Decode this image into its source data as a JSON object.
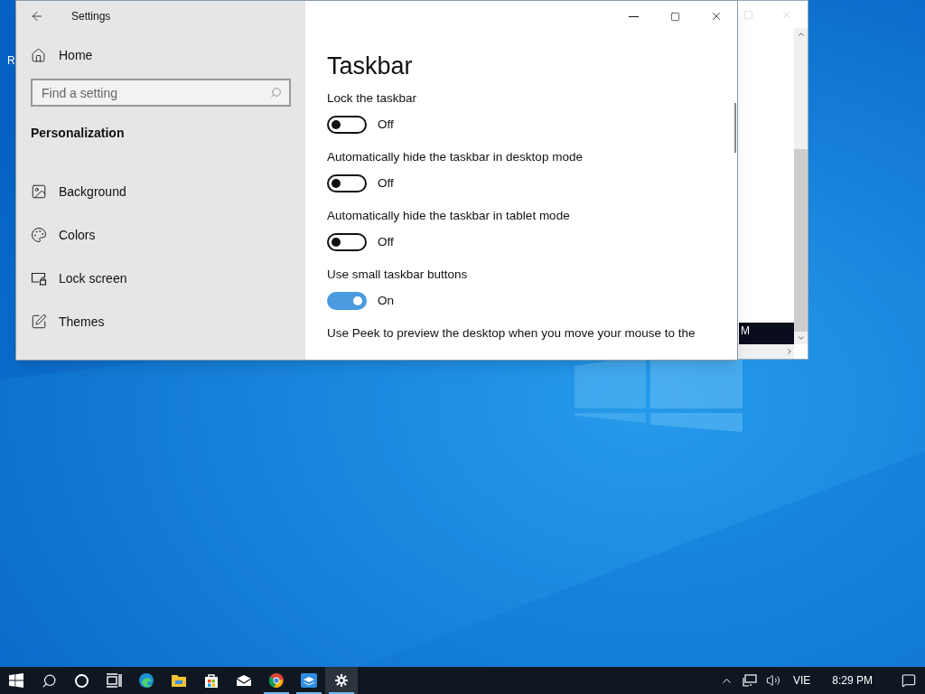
{
  "desktop": {
    "icon_label": "R"
  },
  "background_window": {
    "clock_fragment": "M"
  },
  "window": {
    "title": "Settings"
  },
  "sidebar": {
    "home": "Home",
    "search": {
      "placeholder": "Find a setting"
    },
    "section": "Personalization",
    "items": [
      {
        "label": "Background",
        "selected": false
      },
      {
        "label": "Colors",
        "selected": false
      },
      {
        "label": "Lock screen",
        "selected": false
      },
      {
        "label": "Themes",
        "selected": false
      }
    ]
  },
  "content": {
    "heading": "Taskbar",
    "settings": [
      {
        "label": "Lock the taskbar",
        "on": false,
        "state_text": "Off"
      },
      {
        "label": "Automatically hide the taskbar in desktop mode",
        "on": false,
        "state_text": "Off"
      },
      {
        "label": "Automatically hide the taskbar in tablet mode",
        "on": false,
        "state_text": "Off"
      },
      {
        "label": "Use small taskbar buttons",
        "on": true,
        "state_text": "On"
      }
    ],
    "description": "Use Peek to preview the desktop when you move your mouse to the"
  },
  "taskbar": {
    "apps": [
      {
        "kind": "search"
      },
      {
        "kind": "cortana"
      },
      {
        "kind": "taskview"
      },
      {
        "kind": "edge",
        "running": false
      },
      {
        "kind": "explorer",
        "running": false
      },
      {
        "kind": "store",
        "running": false
      },
      {
        "kind": "mail",
        "running": false
      },
      {
        "kind": "chrome",
        "running": true
      },
      {
        "kind": "app",
        "running": true
      },
      {
        "kind": "settings",
        "running": true,
        "selected": true
      }
    ],
    "language": "VIE",
    "time": "8:29 PM"
  }
}
